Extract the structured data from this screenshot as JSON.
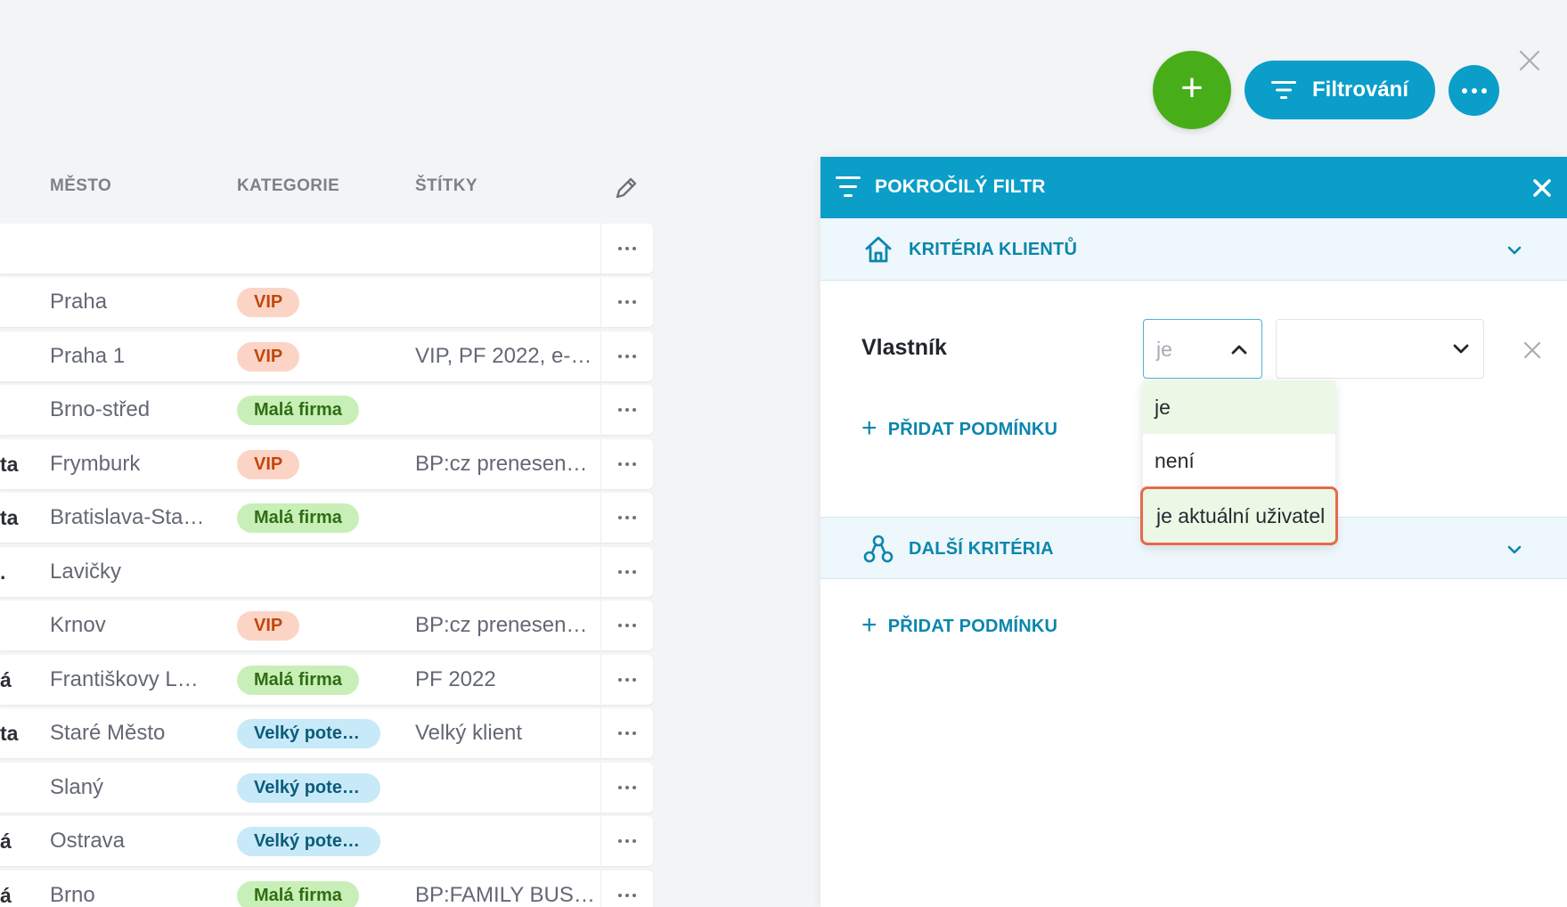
{
  "toolbar": {
    "add_symbol": "+",
    "filter_label": "Filtrování"
  },
  "table": {
    "headers": {
      "city": "MĚSTO",
      "category": "KATEGORIE",
      "tags": "ŠTÍTKY"
    },
    "rows": [
      {
        "cut": "",
        "city": "",
        "category": "",
        "category_type": "",
        "tags": ""
      },
      {
        "cut": "",
        "city": "Praha",
        "category": "VIP",
        "category_type": "vip",
        "tags": ""
      },
      {
        "cut": "",
        "city": "Praha 1",
        "category": "VIP",
        "category_type": "vip",
        "tags": "VIP, PF 2022, e-…"
      },
      {
        "cut": "",
        "city": "Brno-střed",
        "category": "Malá firma",
        "category_type": "mala",
        "tags": ""
      },
      {
        "cut": "ta",
        "city": "Frymburk",
        "category": "VIP",
        "category_type": "vip",
        "tags": "BP:cz prenesen…"
      },
      {
        "cut": "ta",
        "city": "Bratislava-Sta…",
        "category": "Malá firma",
        "category_type": "mala",
        "tags": ""
      },
      {
        "cut": ".",
        "city": "Lavičky",
        "category": "",
        "category_type": "",
        "tags": ""
      },
      {
        "cut": "",
        "city": "Krnov",
        "category": "VIP",
        "category_type": "vip",
        "tags": "BP:cz prenesen…"
      },
      {
        "cut": "á",
        "city": "Františkovy L…",
        "category": "Malá firma",
        "category_type": "mala",
        "tags": "PF 2022"
      },
      {
        "cut": "ta",
        "city": "Staré Město",
        "category": "Velký pote…",
        "category_type": "velky",
        "tags": "Velký klient"
      },
      {
        "cut": "",
        "city": "Slaný",
        "category": "Velký pote…",
        "category_type": "velky",
        "tags": ""
      },
      {
        "cut": "á",
        "city": "Ostrava",
        "category": "Velký pote…",
        "category_type": "velky",
        "tags": ""
      },
      {
        "cut": "á",
        "city": "Brno",
        "category": "Malá firma",
        "category_type": "mala",
        "tags": "BP:FAMILY BUS…"
      }
    ]
  },
  "filter_panel": {
    "title": "POKROČILÝ FILTR",
    "sections": [
      {
        "label": "KRITÉRIA KLIENTŮ",
        "icon": "home-icon"
      },
      {
        "label": "DALŠÍ KRITÉRIA",
        "icon": "network-icon"
      }
    ],
    "condition": {
      "field": "Vlastník",
      "operator": "je",
      "value": ""
    },
    "add_condition_label": "PŘIDAT PODMÍNKU",
    "operator_options": [
      "je",
      "není",
      "je aktuální uživatel"
    ]
  },
  "colors": {
    "primary": "#0a9ec9",
    "add_button": "#47ae19",
    "highlight_border": "#e56a4c"
  }
}
